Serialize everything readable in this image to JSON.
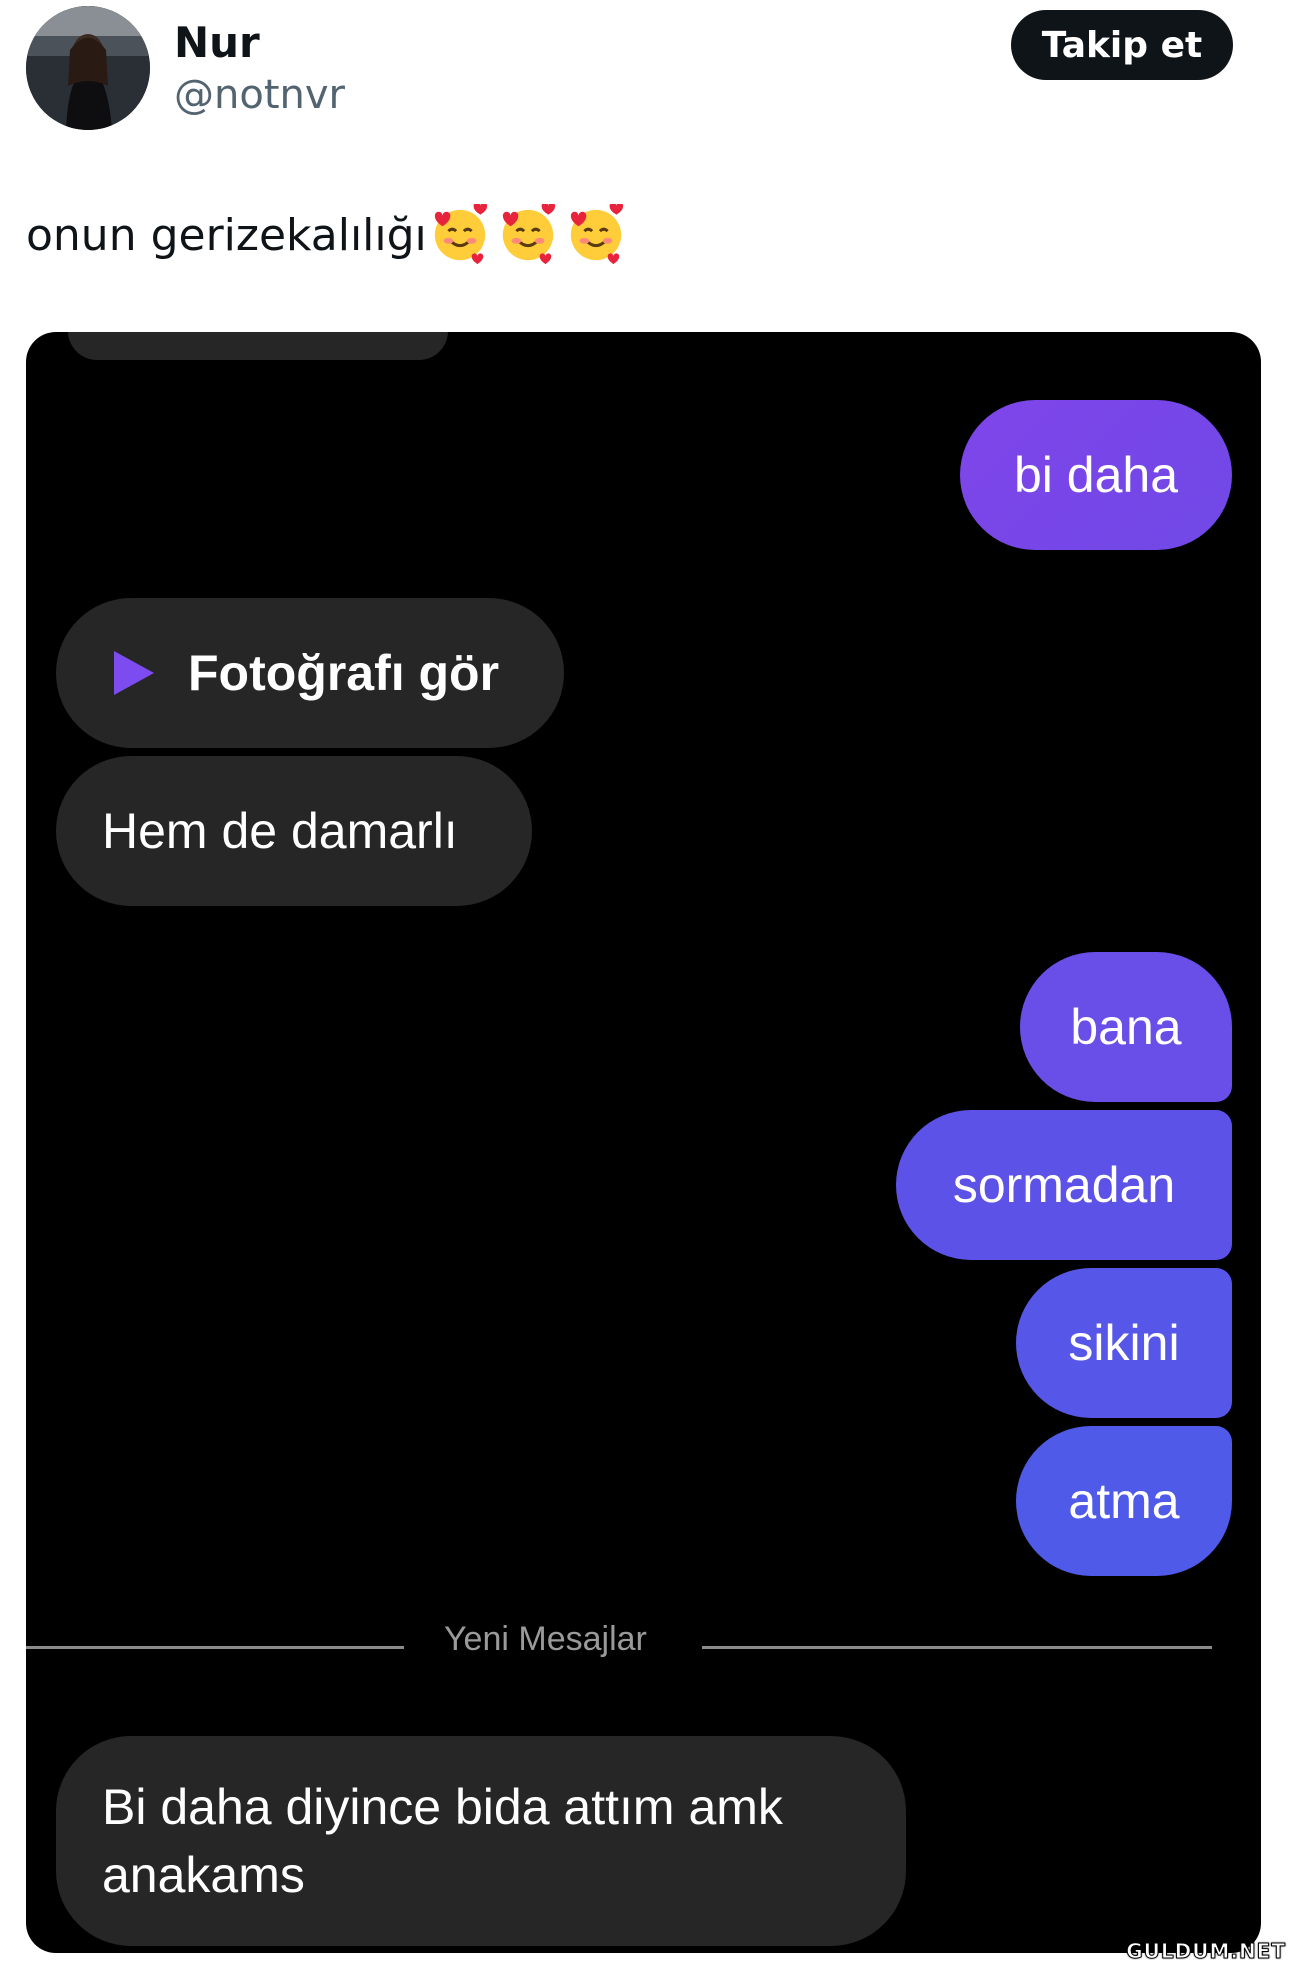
{
  "header": {
    "name": "Nur",
    "handle": "@notnvr",
    "follow_label": "Takip et"
  },
  "tweet": {
    "text": "onun gerizekalılığı",
    "emoji": "smiling-face-with-hearts"
  },
  "chat": {
    "messages": [
      {
        "sender": "me",
        "text": "bi daha"
      },
      {
        "sender": "them",
        "text": "Fotoğrafı gör",
        "type": "media"
      },
      {
        "sender": "them",
        "text": "Hem de damarlı"
      },
      {
        "sender": "me",
        "text": "bana"
      },
      {
        "sender": "me",
        "text": "sormadan"
      },
      {
        "sender": "me",
        "text": "sikini"
      },
      {
        "sender": "me",
        "text": "atma"
      },
      {
        "sender": "them",
        "text": "Bi daha diyince bida attım amk anakams"
      }
    ],
    "divider_label": "Yeni Mesajlar"
  },
  "watermark": "GULDUM.NET",
  "colors": {
    "follow_button": "#0f1419",
    "incoming_bubble": "#262626",
    "outgoing_purple": "#7845e8",
    "outgoing_blue": "#4f5ae8",
    "play_icon": "#7d4cf0"
  }
}
